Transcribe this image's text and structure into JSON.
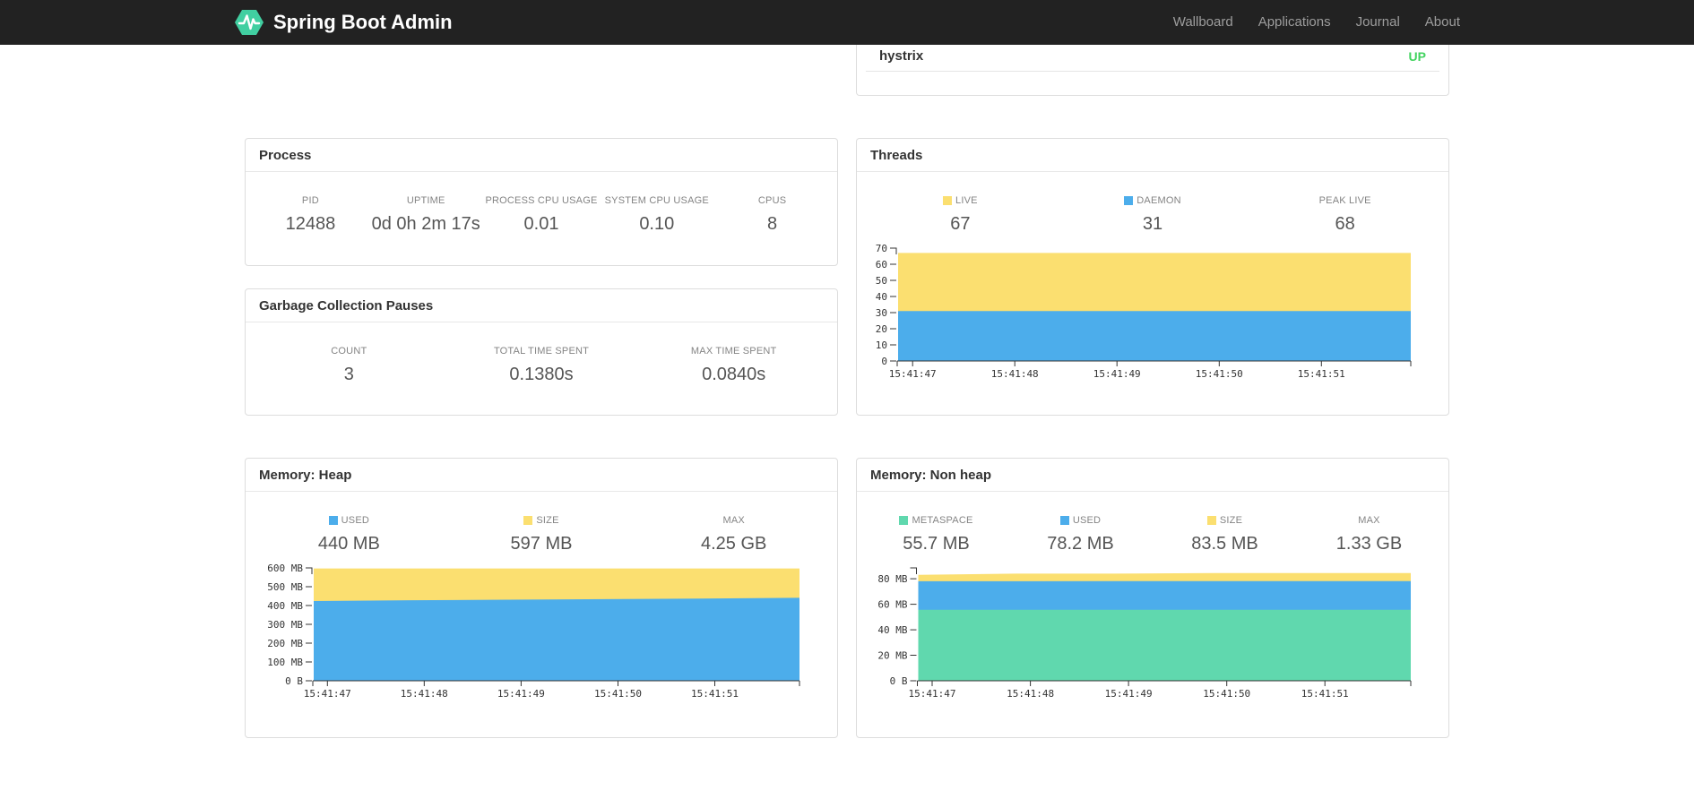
{
  "navbar": {
    "brand": "Spring Boot Admin",
    "brand_color": "#41cfa1",
    "links": [
      {
        "label": "Wallboard"
      },
      {
        "label": "Applications"
      },
      {
        "label": "Journal"
      },
      {
        "label": "About"
      }
    ]
  },
  "application_panel": {
    "name": "hystrix",
    "status": "UP",
    "status_color": "#42d35f"
  },
  "panels": {
    "process": {
      "title": "Process",
      "stats": [
        {
          "label": "PID",
          "value": "12488"
        },
        {
          "label": "UPTIME",
          "value": "0d 0h 2m 17s"
        },
        {
          "label": "PROCESS CPU USAGE",
          "value": "0.01"
        },
        {
          "label": "SYSTEM CPU USAGE",
          "value": "0.10"
        },
        {
          "label": "CPUS",
          "value": "8"
        }
      ]
    },
    "gc": {
      "title": "Garbage Collection Pauses",
      "stats": [
        {
          "label": "COUNT",
          "value": "3"
        },
        {
          "label": "TOTAL TIME SPENT",
          "value": "0.1380s"
        },
        {
          "label": "MAX TIME SPENT",
          "value": "0.0840s"
        }
      ]
    },
    "threads": {
      "title": "Threads",
      "stats": [
        {
          "label": "LIVE",
          "value": "67",
          "swatch": "#fbdf70"
        },
        {
          "label": "DAEMON",
          "value": "31",
          "swatch": "#4cadeb"
        },
        {
          "label": "PEAK LIVE",
          "value": "68"
        }
      ]
    },
    "heap": {
      "title": "Memory: Heap",
      "stats": [
        {
          "label": "USED",
          "value": "440 MB",
          "swatch": "#4cadeb"
        },
        {
          "label": "SIZE",
          "value": "597 MB",
          "swatch": "#fbdf70"
        },
        {
          "label": "MAX",
          "value": "4.25 GB"
        }
      ]
    },
    "nonheap": {
      "title": "Memory: Non heap",
      "stats": [
        {
          "label": "METASPACE",
          "value": "55.7 MB",
          "swatch": "#60d8ae"
        },
        {
          "label": "USED",
          "value": "78.2 MB",
          "swatch": "#4cadeb"
        },
        {
          "label": "SIZE",
          "value": "83.5 MB",
          "swatch": "#fbdf70"
        },
        {
          "label": "MAX",
          "value": "1.33 GB"
        }
      ]
    }
  },
  "chart_data": [
    {
      "id": "threads",
      "type": "area",
      "title": "Threads",
      "legend_position": "top",
      "grid": false,
      "xlabel": "",
      "ylabel": "",
      "x_labels": [
        "15:41:47",
        "15:41:48",
        "15:41:49",
        "15:41:50",
        "15:41:51"
      ],
      "y_max": 70,
      "y_ticks": [
        {
          "v": 0,
          "label": "0"
        },
        {
          "v": 10,
          "label": "10"
        },
        {
          "v": 20,
          "label": "20"
        },
        {
          "v": 30,
          "label": "30"
        },
        {
          "v": 40,
          "label": "40"
        },
        {
          "v": 50,
          "label": "50"
        },
        {
          "v": 60,
          "label": "60"
        },
        {
          "v": 70,
          "label": "70"
        }
      ],
      "series": [
        {
          "name": "LIVE",
          "color": "#fbdf70",
          "values": [
            67,
            67,
            67,
            67,
            67,
            67
          ]
        },
        {
          "name": "DAEMON",
          "color": "#4cadeb",
          "values": [
            31,
            31,
            31,
            31,
            31,
            31
          ]
        }
      ]
    },
    {
      "id": "heap",
      "type": "area",
      "title": "Memory: Heap (MB)",
      "legend_position": "top",
      "grid": false,
      "xlabel": "",
      "ylabel": "",
      "x_labels": [
        "15:41:47",
        "15:41:48",
        "15:41:49",
        "15:41:50",
        "15:41:51"
      ],
      "y_max": 600,
      "y_ticks": [
        {
          "v": 0,
          "label": "0 B"
        },
        {
          "v": 100,
          "label": "100 MB"
        },
        {
          "v": 200,
          "label": "200 MB"
        },
        {
          "v": 300,
          "label": "300 MB"
        },
        {
          "v": 400,
          "label": "400 MB"
        },
        {
          "v": 500,
          "label": "500 MB"
        },
        {
          "v": 600,
          "label": "600 MB"
        }
      ],
      "series": [
        {
          "name": "SIZE",
          "color": "#fbdf70",
          "values": [
            597,
            597,
            597,
            597,
            597,
            597
          ]
        },
        {
          "name": "USED",
          "color": "#4cadeb",
          "values": [
            424,
            428,
            431,
            434,
            437,
            441
          ]
        }
      ]
    },
    {
      "id": "nonheap",
      "type": "area",
      "title": "Memory: Non heap (MB)",
      "legend_position": "top",
      "grid": false,
      "xlabel": "",
      "ylabel": "",
      "x_labels": [
        "15:41:47",
        "15:41:48",
        "15:41:49",
        "15:41:50",
        "15:41:51"
      ],
      "y_max": 88.5,
      "y_ticks": [
        {
          "v": 0,
          "label": "0 B"
        },
        {
          "v": 20,
          "label": "20 MB"
        },
        {
          "v": 40,
          "label": "40 MB"
        },
        {
          "v": 60,
          "label": "60 MB"
        },
        {
          "v": 80,
          "label": "80 MB"
        }
      ],
      "series": [
        {
          "name": "SIZE",
          "color": "#fbdf70",
          "values": [
            83,
            84,
            84,
            84.5,
            84.5,
            84.5
          ]
        },
        {
          "name": "USED",
          "color": "#4cadeb",
          "values": [
            78,
            78,
            78.2,
            78.2,
            78.2,
            78.2
          ]
        },
        {
          "name": "METASPACE",
          "color": "#60d8ae",
          "values": [
            55.7,
            55.7,
            55.7,
            55.7,
            55.7,
            55.7
          ]
        }
      ]
    }
  ]
}
